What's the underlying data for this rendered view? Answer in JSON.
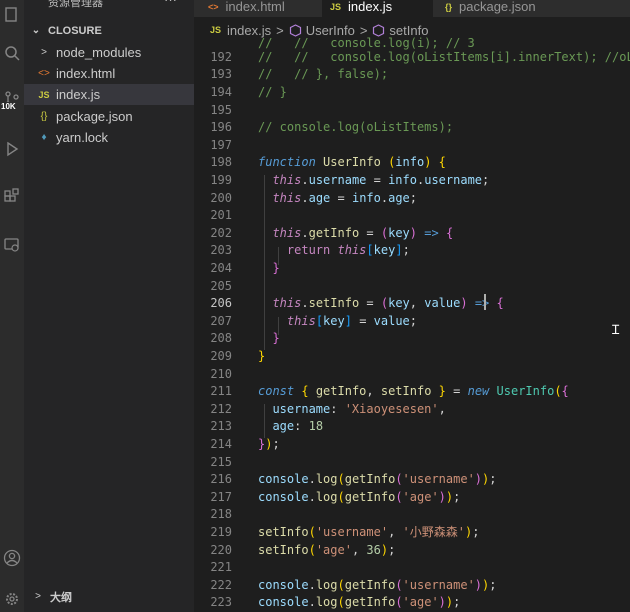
{
  "sidebar": {
    "title": "资源管理器",
    "more": "···",
    "folder": "CLOSURE",
    "items": [
      {
        "label": "node_modules",
        "icon": "chevron-right-icon",
        "glyph": ">",
        "color": "#cccccc"
      },
      {
        "label": "index.html",
        "icon": "html-file-icon",
        "glyph": "<>",
        "color": "#e37933"
      },
      {
        "label": "index.js",
        "icon": "js-file-icon",
        "glyph": "JS",
        "color": "#cbcb41"
      },
      {
        "label": "package.json",
        "icon": "json-file-icon",
        "glyph": "{}",
        "color": "#cbcb41"
      },
      {
        "label": "yarn.lock",
        "icon": "yarn-file-icon",
        "glyph": "♦",
        "color": "#519aba"
      }
    ],
    "outline": "大纲",
    "badge": "10K"
  },
  "tabs": [
    {
      "label": "index.html",
      "glyph": "<>",
      "color": "#e37933"
    },
    {
      "label": "index.js",
      "glyph": "JS",
      "color": "#cbcb41"
    },
    {
      "label": "package.json",
      "glyph": "{}",
      "color": "#cbcb41"
    }
  ],
  "breadcrumb": {
    "file": "index.js",
    "file_glyph": "JS",
    "sep": ">",
    "cls": "UserInfo",
    "method": "setInfo"
  },
  "editor": {
    "line_numbers": [
      "192",
      "193",
      "194",
      "195",
      "196",
      "197",
      "198",
      "199",
      "200",
      "201",
      "202",
      "203",
      "204",
      "205",
      "206",
      "207",
      "208",
      "209",
      "210",
      "211",
      "212",
      "213",
      "214",
      "215",
      "216",
      "217",
      "218",
      "219",
      "220",
      "221",
      "222",
      "223"
    ],
    "current_line": "206",
    "t191": "//   //   console.log(i); // 3",
    "t192": "//   //   console.log(oListItems[i].innerText); //oLi",
    "t193": "//   // }, false);",
    "t194": "// }",
    "t196": "// console.log(oListItems);",
    "kw_function": "function",
    "name_userinfo": "UserInfo",
    "param_info": "info",
    "kw_this": "this",
    "prop_username": "username",
    "prop_age": "age",
    "prop_getinfo": "getInfo",
    "prop_setinfo": "setInfo",
    "param_key": "key",
    "param_value": "value",
    "kw_return": "return",
    "kw_const": "const",
    "kw_new": "new",
    "obj_console": "console",
    "fn_log": "log",
    "str_username": "'username'",
    "str_age": "'age'",
    "str_xiaoyesesen": "'Xiaoyesesen'",
    "str_chinese": "'小野森森'",
    "num_18": "18",
    "num_36": "36"
  }
}
